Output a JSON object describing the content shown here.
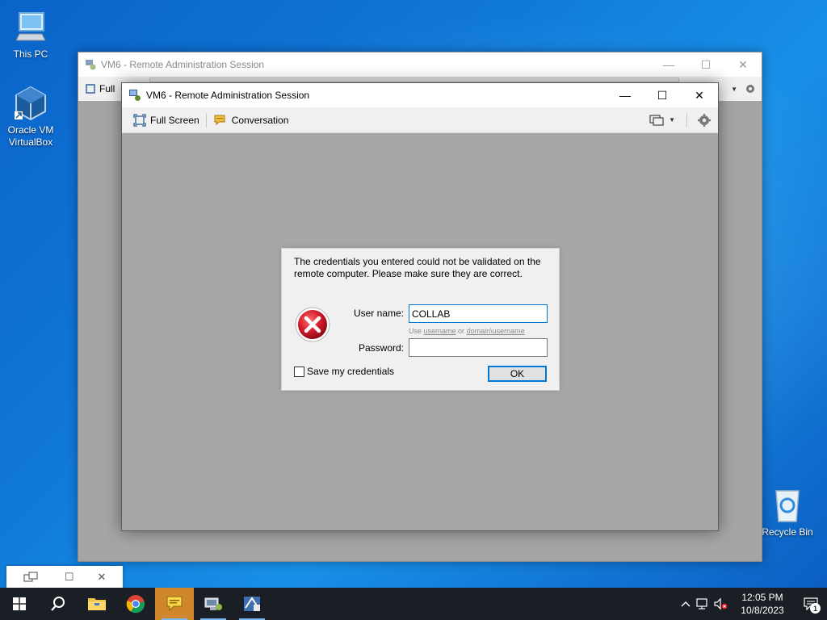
{
  "desktop": {
    "icons": [
      {
        "label": "This PC"
      },
      {
        "label": "Oracle VM VirtualBox"
      },
      {
        "label": "Recycle Bin"
      }
    ]
  },
  "back_window": {
    "title": "VM6 - Remote Administration Session",
    "toolbar_partial_label": "Full"
  },
  "front_window": {
    "title": "VM6 - Remote Administration Session",
    "toolbar": {
      "full_screen_label": "Full Screen",
      "conversation_label": "Conversation"
    }
  },
  "dialog": {
    "message": "The credentials you entered could not be validated on the remote computer. Please make sure they are correct.",
    "username_label": "User name:",
    "username_value": "COLLAB",
    "hint_prefix": "Use ",
    "hint_username": "username",
    "hint_or": " or ",
    "hint_domain_username": "domain\\username",
    "password_label": "Password:",
    "password_value": "",
    "save_credentials_label": "Save my credentials",
    "save_credentials_checked": false,
    "ok_label": "OK"
  },
  "taskbar": {
    "clock_time": "12:05 PM",
    "clock_date": "10/8/2023",
    "notification_count": "1"
  },
  "colors": {
    "accent": "#0078d7",
    "desktop_blue": "#1078d8",
    "taskbar": "#1a1f25",
    "active_taskbar_app": "#d0862a",
    "error_red": "#c8102e"
  }
}
